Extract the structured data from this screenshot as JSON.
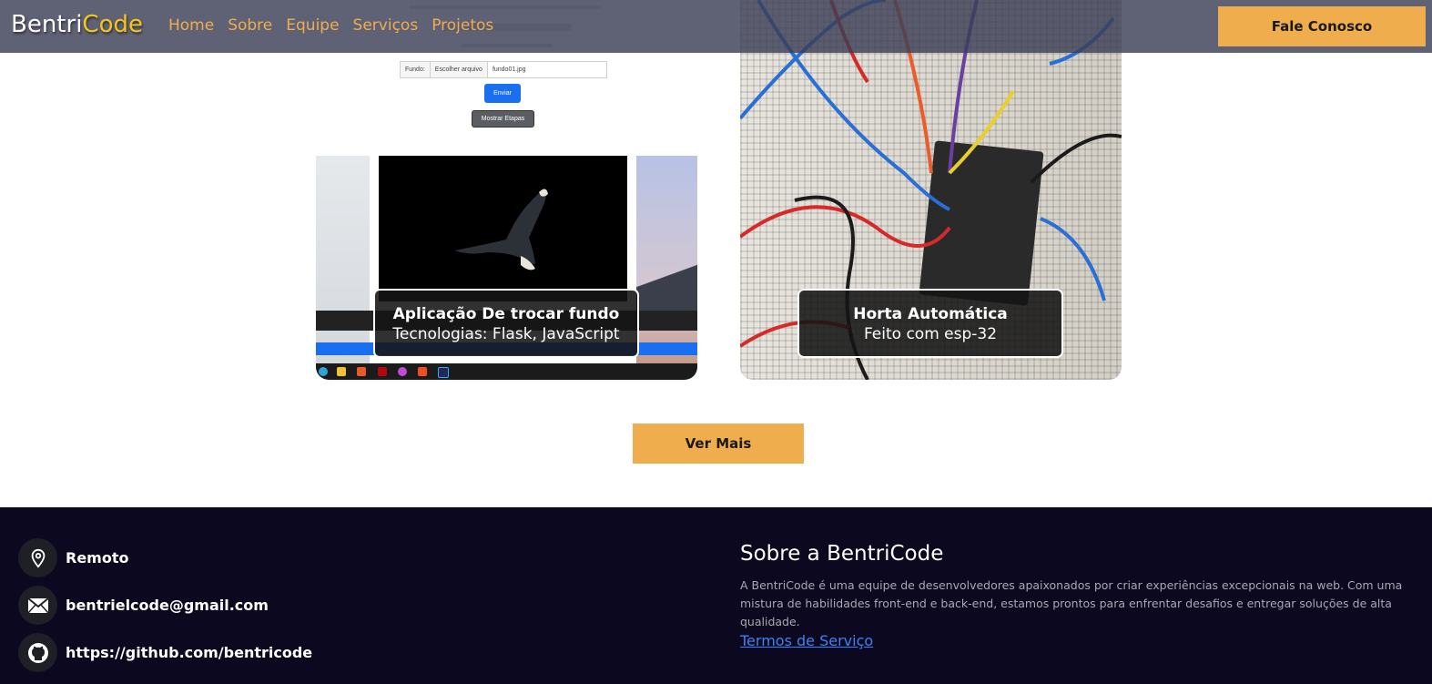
{
  "header": {
    "logo_part1": "Bentri",
    "logo_part2": "Code",
    "nav": [
      "Home",
      "Sobre",
      "Equipe",
      "Serviços",
      "Projetos"
    ],
    "cta_label": "Fale Conosco"
  },
  "projects": [
    {
      "title": "Aplicação De trocar fundo",
      "subtitle": "Tecnologias: Flask, JavaScript",
      "thumb": {
        "form_label": "Fundo:",
        "choose_label": "Escolher arquivo",
        "file_name": "fundo01.jpg",
        "send_label": "Enviar",
        "steps_label": "Mostrar Etapas"
      }
    },
    {
      "title": "Horta Automática",
      "subtitle": "Feito com esp-32"
    }
  ],
  "more_label": "Ver Mais",
  "footer": {
    "contacts": [
      {
        "icon": "location-pin-icon",
        "text": "Remoto"
      },
      {
        "icon": "mail-icon",
        "text": "bentrielcode@gmail.com"
      },
      {
        "icon": "github-icon",
        "text": "https://github.com/bentricode"
      }
    ],
    "about_title": "Sobre a BentriCode",
    "about_text": "A BentriCode é uma equipe de desenvolvedores apaixonados por criar experiências excepcionais na web. Com uma mistura de habilidades front-end e back-end, estamos prontos para enfrentar desafios e entregar soluções de alta qualidade.",
    "terms_label": "Termos de Serviço"
  },
  "colors": {
    "accent": "#f0ad4e",
    "logo_highlight": "#f5c518",
    "footer_bg": "#0b0820",
    "link": "#3b82f6"
  }
}
